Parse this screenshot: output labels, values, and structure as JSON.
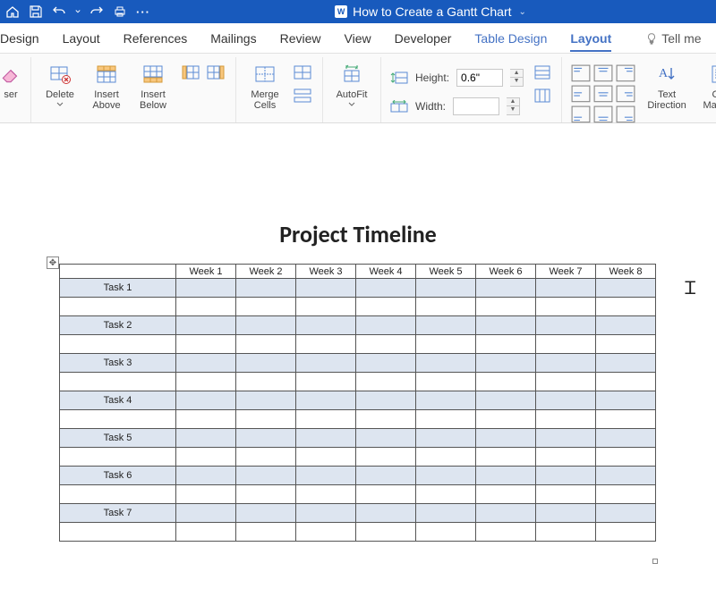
{
  "titlebar": {
    "doc_title": "How to Create a Gantt Chart"
  },
  "tabs": {
    "design": "Design",
    "layout": "Layout",
    "references": "References",
    "mailings": "Mailings",
    "review": "Review",
    "view": "View",
    "developer": "Developer",
    "table_design": "Table Design",
    "table_layout": "Layout",
    "tell_me": "Tell me"
  },
  "ribbon": {
    "ser": "ser",
    "delete": "Delete",
    "insert_above": "Insert Above",
    "insert_below": "Insert Below",
    "merge_cells": "Merge Cells",
    "autofit": "AutoFit",
    "height": "Height:",
    "height_val": "0.6\"",
    "width": "Width:",
    "width_val": "",
    "text_direction": "Text Direction",
    "cell_margins": "Cell Margins"
  },
  "document": {
    "title": "Project Timeline",
    "weeks": [
      "Week 1",
      "Week 2",
      "Week 3",
      "Week 4",
      "Week 5",
      "Week 6",
      "Week 7",
      "Week 8"
    ],
    "tasks": [
      "Task 1",
      "Task 2",
      "Task 3",
      "Task 4",
      "Task 5",
      "Task 6",
      "Task 7"
    ]
  },
  "chart_data": {
    "type": "table",
    "title": "Project Timeline",
    "columns": [
      "",
      "Week 1",
      "Week 2",
      "Week 3",
      "Week 4",
      "Week 5",
      "Week 6",
      "Week 7",
      "Week 8"
    ],
    "rows": [
      "Task 1",
      "Task 2",
      "Task 3",
      "Task 4",
      "Task 5",
      "Task 6",
      "Task 7"
    ],
    "note": "Gantt grid is empty; no bars filled yet"
  }
}
